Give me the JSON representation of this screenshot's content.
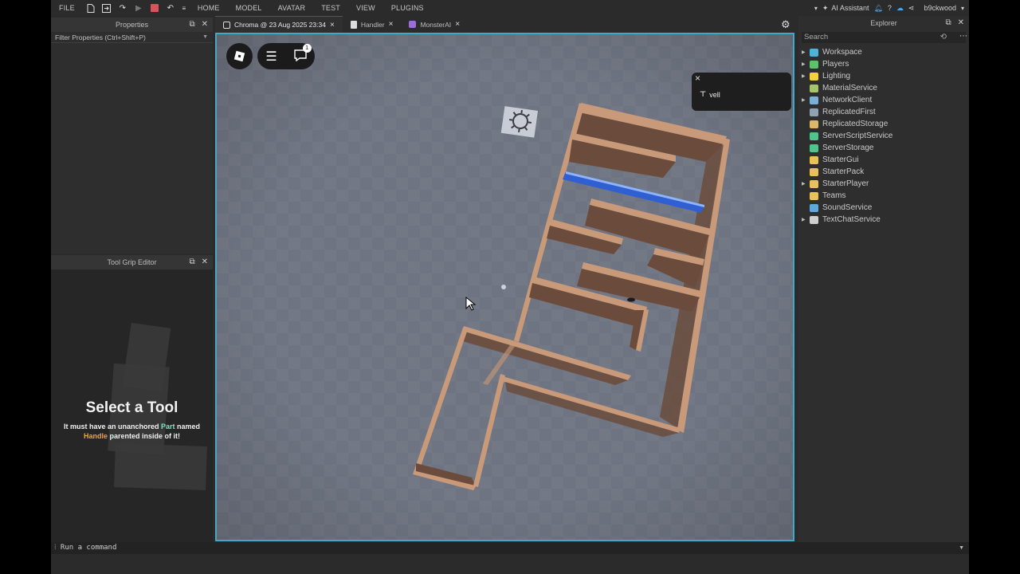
{
  "topbar": {
    "menus": [
      "FILE",
      "HOME",
      "MODEL",
      "AVATAR",
      "TEST",
      "VIEW",
      "PLUGINS"
    ],
    "ai_label": "AI Assistant",
    "username": "b9ckwood"
  },
  "properties": {
    "title": "Properties",
    "filter_placeholder": "Filter Properties (Ctrl+Shift+P)"
  },
  "grip": {
    "title": "Tool Grip Editor",
    "heading": "Select a Tool",
    "line1_a": "It must have an unanchored ",
    "line1_part": "Part",
    "line1_b": " named",
    "line2_handle": "Handle",
    "line2_b": " parented inside of it!"
  },
  "tabs": [
    {
      "label": "Chroma @ 23 Aug 2025 23:34",
      "icon": "place-icon",
      "active": true
    },
    {
      "label": "Handler",
      "icon": "script-icon",
      "active": false
    },
    {
      "label": "MonsterAI",
      "icon": "module-icon",
      "active": false
    }
  ],
  "viewport": {
    "chat_badge": "1",
    "notification_text": "vell"
  },
  "explorer": {
    "title": "Explorer",
    "search_placeholder": "Search",
    "items": [
      {
        "label": "Workspace",
        "icon": "workspace-icon",
        "color": "#4fb3d9",
        "expandable": true
      },
      {
        "label": "Players",
        "icon": "players-icon",
        "color": "#5bc46a",
        "expandable": true
      },
      {
        "label": "Lighting",
        "icon": "lightbulb-icon",
        "color": "#f2d13c",
        "expandable": true
      },
      {
        "label": "MaterialService",
        "icon": "material-icon",
        "color": "#a6c46a",
        "expandable": false
      },
      {
        "label": "NetworkClient",
        "icon": "network-icon",
        "color": "#7ab0d6",
        "expandable": true
      },
      {
        "label": "ReplicatedFirst",
        "icon": "replicated-first-icon",
        "color": "#8fa1b3",
        "expandable": false
      },
      {
        "label": "ReplicatedStorage",
        "icon": "replicated-storage-icon",
        "color": "#d9b86b",
        "expandable": false
      },
      {
        "label": "ServerScriptService",
        "icon": "server-script-icon",
        "color": "#4fc48c",
        "expandable": false
      },
      {
        "label": "ServerStorage",
        "icon": "server-storage-icon",
        "color": "#4fc48c",
        "expandable": false
      },
      {
        "label": "StarterGui",
        "icon": "starter-gui-icon",
        "color": "#e8c15a",
        "expandable": false
      },
      {
        "label": "StarterPack",
        "icon": "starter-pack-icon",
        "color": "#e8c15a",
        "expandable": false
      },
      {
        "label": "StarterPlayer",
        "icon": "starter-player-icon",
        "color": "#e8c15a",
        "expandable": true
      },
      {
        "label": "Teams",
        "icon": "teams-icon",
        "color": "#e8c15a",
        "expandable": false
      },
      {
        "label": "SoundService",
        "icon": "sound-icon",
        "color": "#5fa8d9",
        "expandable": false
      },
      {
        "label": "TextChatService",
        "icon": "text-chat-icon",
        "color": "#cfcfcf",
        "expandable": true
      }
    ]
  },
  "command_bar": {
    "placeholder": "Run a command"
  },
  "colors": {
    "viewport_border": "#41a8c9",
    "wall_face": "#c99a7a",
    "wall_floor": "#6b4c3c",
    "water": "#2f5fd1"
  }
}
